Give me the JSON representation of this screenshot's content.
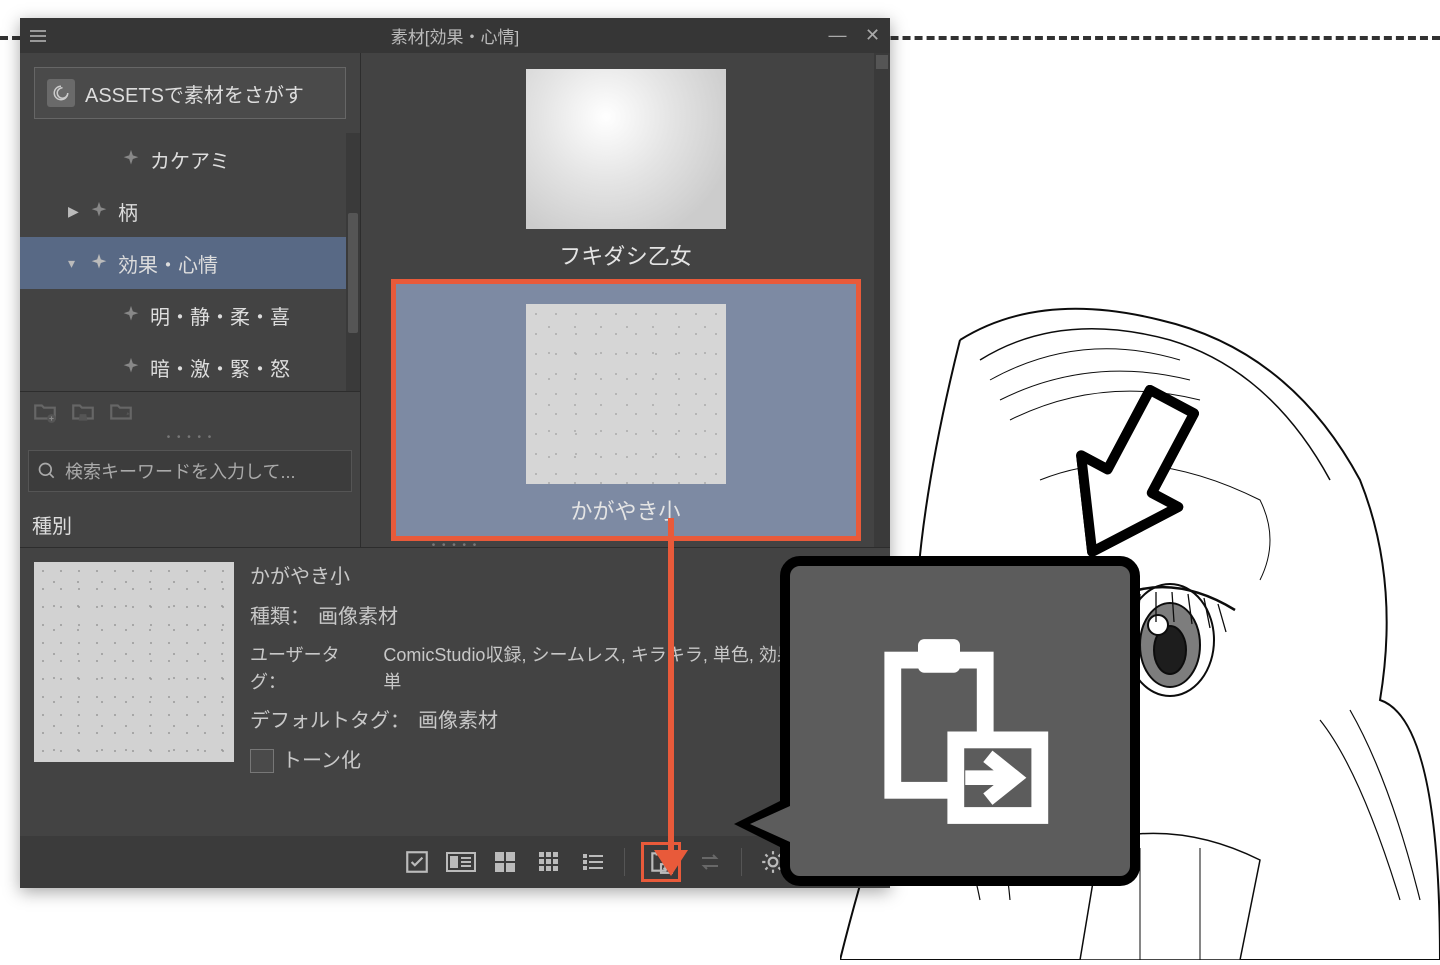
{
  "window": {
    "title": "素材[効果・心情]"
  },
  "assets_button": "ASSETSで素材をさがす",
  "tree": {
    "item_truncated": "カケアミ",
    "item_pattern": "柄",
    "item_effect": "効果・心情",
    "item_light": "明・静・柔・喜",
    "item_dark": "暗・激・緊・怒"
  },
  "search": {
    "placeholder": "検索キーワードを入力して..."
  },
  "kind_label": "種別",
  "gallery": {
    "item1": "フキダシ乙女",
    "item2": "かがやき小"
  },
  "detail": {
    "name": "かがやき小",
    "type_label": "種類：",
    "type_value": "画像素材",
    "usertag_label": "ユーザータグ：",
    "usertag_value": "ComicStudio収録, シームレス, キラキラ, 単色, 効果・心情, 単",
    "deftag_label": "デフォルトタグ：",
    "deftag_value": "画像素材",
    "tone_label": "トーン化"
  }
}
